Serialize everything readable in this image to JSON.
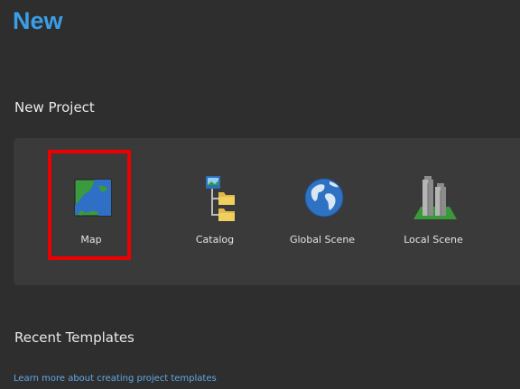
{
  "page": {
    "title": "New"
  },
  "new_project": {
    "heading": "New Project",
    "tiles": [
      {
        "label": "Map",
        "icon": "map-icon"
      },
      {
        "label": "Catalog",
        "icon": "catalog-icon"
      },
      {
        "label": "Global Scene",
        "icon": "globe-icon"
      },
      {
        "label": "Local Scene",
        "icon": "local-scene-icon"
      }
    ],
    "highlighted_tile": "Map"
  },
  "recent_templates": {
    "heading": "Recent Templates",
    "link": "Learn more about creating project templates"
  },
  "colors": {
    "background": "#2e2e2e",
    "panel": "#3a3a3a",
    "title_accent": "#3a9ee8",
    "highlight": "#ee0000",
    "link": "#62aae8"
  }
}
